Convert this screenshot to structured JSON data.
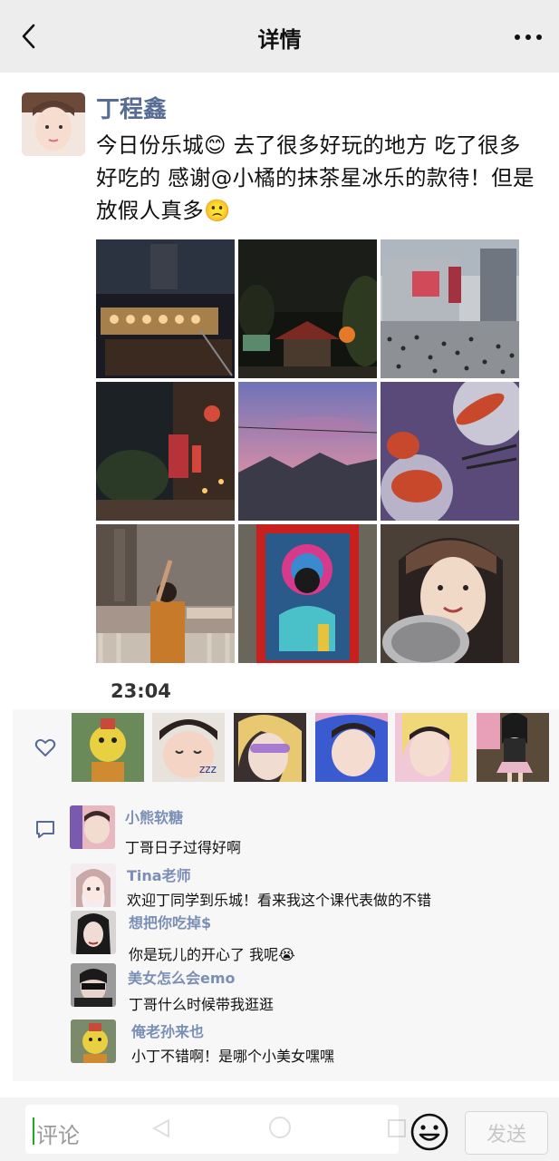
{
  "header": {
    "title": "详情"
  },
  "post": {
    "author": "丁程鑫",
    "text": "今日份乐城😊 去了很多好玩的地方 吃了很多好吃的 感谢@小橘的抹茶星冰乐的款待！但是放假人真多🙁",
    "time": "23:04",
    "photos": [
      {
        "name": "photo-night-market",
        "icon": "night-lanterns-scene"
      },
      {
        "name": "photo-night-temple",
        "icon": "night-building-scene"
      },
      {
        "name": "photo-city-crowd",
        "icon": "crowd-street-scene"
      },
      {
        "name": "photo-red-lantern-street",
        "icon": "lantern-street-scene"
      },
      {
        "name": "photo-sunset-mountains",
        "icon": "sunset-scene"
      },
      {
        "name": "photo-bbq-skewers",
        "icon": "food-scene"
      },
      {
        "name": "photo-river-night",
        "icon": "river-scene"
      },
      {
        "name": "photo-opera-mask",
        "icon": "opera-mask-scene"
      },
      {
        "name": "photo-selfie-bowl",
        "icon": "selfie-scene"
      }
    ]
  },
  "likes": {
    "avatars": [
      "liker-1",
      "liker-2",
      "liker-3",
      "liker-4",
      "liker-5",
      "liker-6"
    ]
  },
  "comments": [
    {
      "name": "小熊软糖",
      "text": "丁哥日子过得好啊"
    },
    {
      "name": "Tina老师",
      "text": "欢迎丁同学到乐城！看来我这个课代表做的不错"
    },
    {
      "name": "想把你吃掉$",
      "text": "你是玩儿的开心了 我呢😭"
    },
    {
      "name": "美女怎么会emo",
      "text": "丁哥什么时候带我逛逛"
    },
    {
      "name": "俺老孙来也",
      "text": "小丁不错啊！是哪个小美女嘿嘿"
    }
  ],
  "composer": {
    "placeholder": "评论",
    "send_label": "发送"
  },
  "colors": {
    "name_blue": "#576b95",
    "comment_name": "#7b8fb6",
    "panel": "#f7f7f7",
    "header_bg": "#ededed"
  }
}
